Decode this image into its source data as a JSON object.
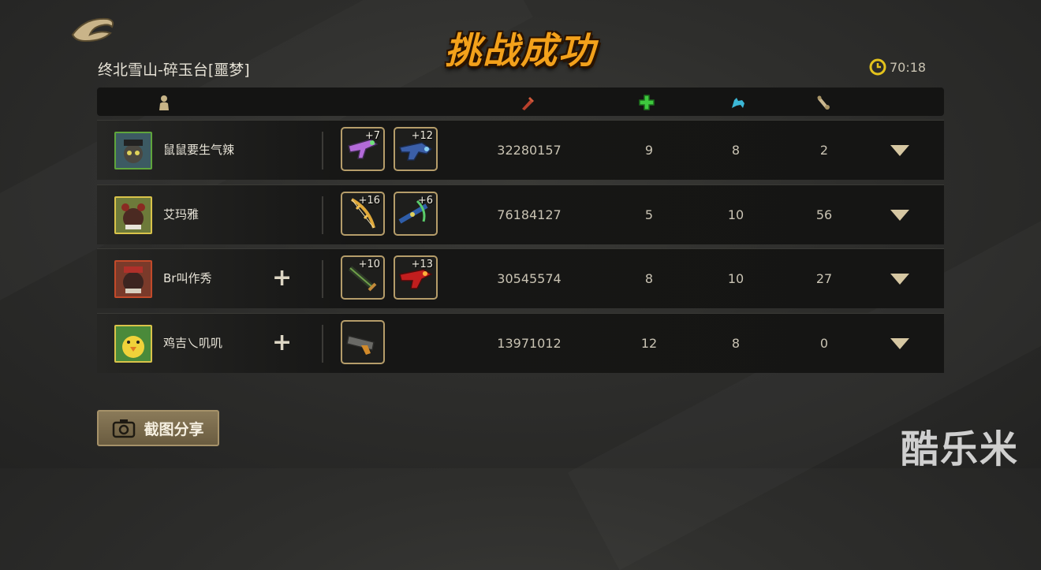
{
  "title": "挑战成功",
  "stage": "终北雪山-碎玉台[噩梦]",
  "timer": "70:18",
  "header_icons": [
    "player-icon",
    "damage-icon",
    "heal-icon",
    "pet-icon",
    "scroll-icon"
  ],
  "players": [
    {
      "name": "鼠鼠要生气辣",
      "has_add": false,
      "weapons": [
        {
          "level": "+7",
          "icon": "purple-gun-icon"
        },
        {
          "level": "+12",
          "icon": "blue-blaster-icon"
        }
      ],
      "damage": "32280157",
      "heal": "9",
      "pet": "8",
      "scroll": "2"
    },
    {
      "name": "艾玛雅",
      "has_add": false,
      "weapons": [
        {
          "level": "+16",
          "icon": "golden-bow-icon"
        },
        {
          "level": "+6",
          "icon": "green-crossbow-icon"
        }
      ],
      "damage": "76184127",
      "heal": "5",
      "pet": "10",
      "scroll": "56"
    },
    {
      "name": "Br叫作秀",
      "has_add": true,
      "weapons": [
        {
          "level": "+10",
          "icon": "green-sword-icon"
        },
        {
          "level": "+13",
          "icon": "red-gun-icon"
        }
      ],
      "damage": "30545574",
      "heal": "8",
      "pet": "10",
      "scroll": "27"
    },
    {
      "name": "鸡吉乀叽叽",
      "has_add": true,
      "weapons": [
        {
          "level": "",
          "icon": "gray-launcher-icon"
        }
      ],
      "damage": "13971012",
      "heal": "12",
      "pet": "8",
      "scroll": "0"
    }
  ],
  "share_button": "截图分享",
  "watermark": "酷乐米",
  "colors": {
    "title": "#f3a11b",
    "heal": "#3ec93e",
    "pet": "#3cb7d6",
    "damage": "#b8402c"
  }
}
